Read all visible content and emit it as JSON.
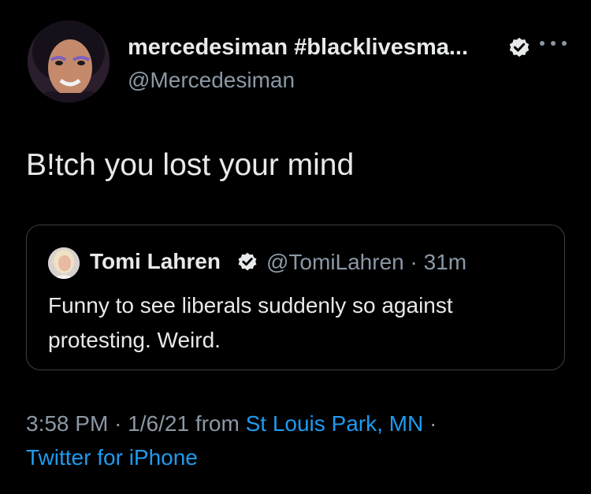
{
  "tweet": {
    "author_name": "mercedesiman #blacklivesma...",
    "author_handle": "@Mercedesiman",
    "text": "B!tch you lost your mind",
    "time": "3:58 PM",
    "date": "1/6/21",
    "from_label": "from",
    "location": "St Louis Park, MN",
    "separator": "·",
    "source": "Twitter for iPhone"
  },
  "quoted": {
    "author_name": "Tomi Lahren",
    "author_handle": "@TomiLahren",
    "age": "31m",
    "separator": "·",
    "text": "Funny to see liberals suddenly so against protesting. Weird."
  },
  "icons": {
    "verified": "verified-badge-icon",
    "more": "more-horizontal-icon"
  },
  "colors": {
    "background": "#000000",
    "primary_text": "#e7e9ea",
    "secondary_text": "#8b98a5",
    "link": "#1d9bf0",
    "border": "#3a3f45"
  }
}
